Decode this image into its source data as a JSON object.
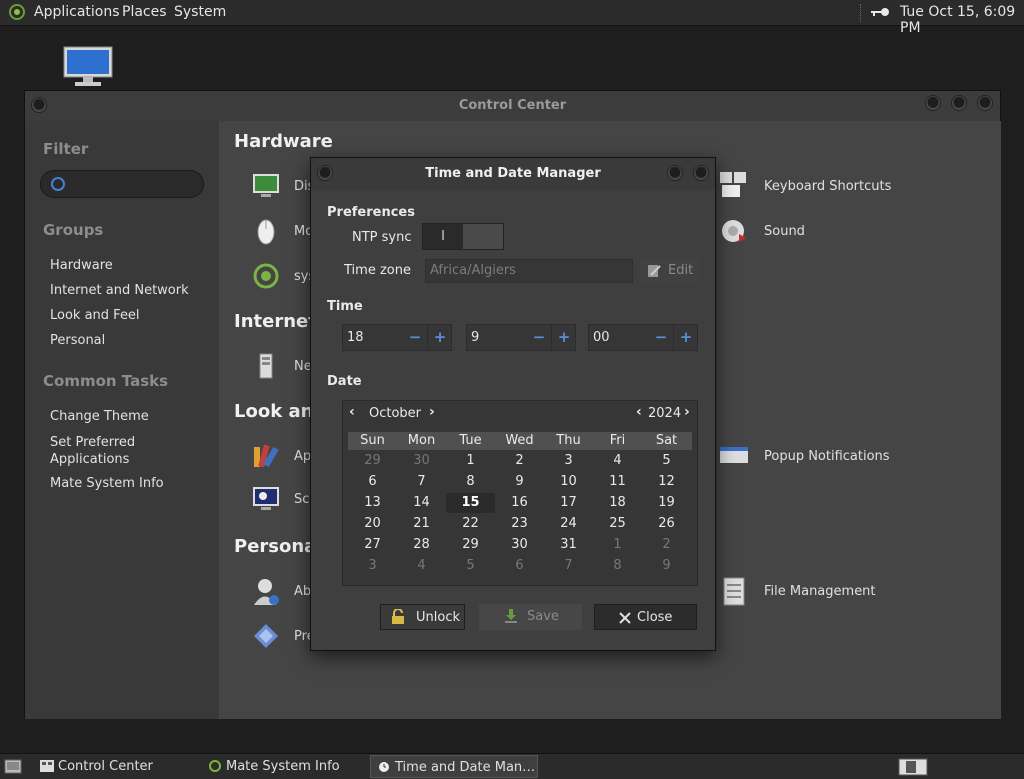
{
  "top_panel": {
    "menus": [
      "Applications",
      "Places",
      "System"
    ],
    "clock": "Tue Oct 15,  6:09 PM"
  },
  "control_center": {
    "title": "Control Center",
    "sidebar": {
      "filter_heading": "Filter",
      "filter_value": "",
      "groups_heading": "Groups",
      "groups": [
        "Hardware",
        "Internet and Network",
        "Look and Feel",
        "Personal"
      ],
      "tasks_heading": "Common Tasks",
      "tasks": [
        "Change Theme",
        "Set Preferred\nApplications",
        "Mate System Info"
      ]
    },
    "sections": {
      "hardware": "Hardware",
      "internet": "Internet a",
      "look": "Look and",
      "personal": "Personal"
    },
    "apps": {
      "display": "Dis",
      "mouse": "Mo",
      "system": "sys",
      "network": "Ne",
      "appearance": "Ap",
      "screensaver": "Scr",
      "about": "Ab",
      "preferred": "Pre",
      "keyboard": "Keyboard Shortcuts",
      "sound": "Sound",
      "popup": "Popup Notifications",
      "file": "File Management"
    }
  },
  "dialog": {
    "title": "Time and Date Manager",
    "preferences_heading": "Preferences",
    "ntp_label": "NTP sync",
    "ntp_state": "I",
    "timezone_label": "Time zone",
    "timezone_placeholder": "Africa/Algiers",
    "edit_label": "Edit",
    "time_heading": "Time",
    "hour": "18",
    "minute": "9",
    "second": "00",
    "date_heading": "Date",
    "month": "October",
    "year": "2024",
    "weekdays": [
      "Sun",
      "Mon",
      "Tue",
      "Wed",
      "Thu",
      "Fri",
      "Sat"
    ],
    "weeks": [
      [
        "29",
        "30",
        "1",
        "2",
        "3",
        "4",
        "5"
      ],
      [
        "6",
        "7",
        "8",
        "9",
        "10",
        "11",
        "12"
      ],
      [
        "13",
        "14",
        "15",
        "16",
        "17",
        "18",
        "19"
      ],
      [
        "20",
        "21",
        "22",
        "23",
        "24",
        "25",
        "26"
      ],
      [
        "27",
        "28",
        "29",
        "30",
        "31",
        "1",
        "2"
      ],
      [
        "3",
        "4",
        "5",
        "6",
        "7",
        "8",
        "9"
      ]
    ],
    "selected_day": "15",
    "unlock_label": "Unlock",
    "save_label": "Save",
    "close_label": "Close"
  },
  "taskbar": {
    "tasks": [
      "Control Center",
      "Mate System Info",
      "Time and Date Man…"
    ]
  }
}
